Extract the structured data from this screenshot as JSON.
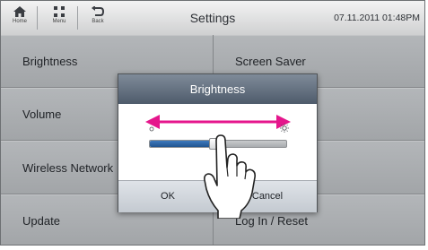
{
  "topbar": {
    "nav": [
      {
        "label": "Home",
        "icon": "home-icon"
      },
      {
        "label": "Menu",
        "icon": "menu-grid-icon"
      },
      {
        "label": "Back",
        "icon": "back-icon"
      }
    ],
    "title": "Settings",
    "datetime": "07.11.2011 01:48PM"
  },
  "menu": {
    "left": [
      "Brightness",
      "Volume",
      "Wireless Network",
      "Update"
    ],
    "right": [
      "Screen Saver",
      "",
      "",
      "Log In / Reset"
    ]
  },
  "dialog": {
    "title": "Brightness",
    "ok_label": "OK",
    "cancel_label": "Cancel",
    "brightness_level": 0.47,
    "arrow_color": "#e5168c",
    "accent_color": "#2b62a3"
  }
}
